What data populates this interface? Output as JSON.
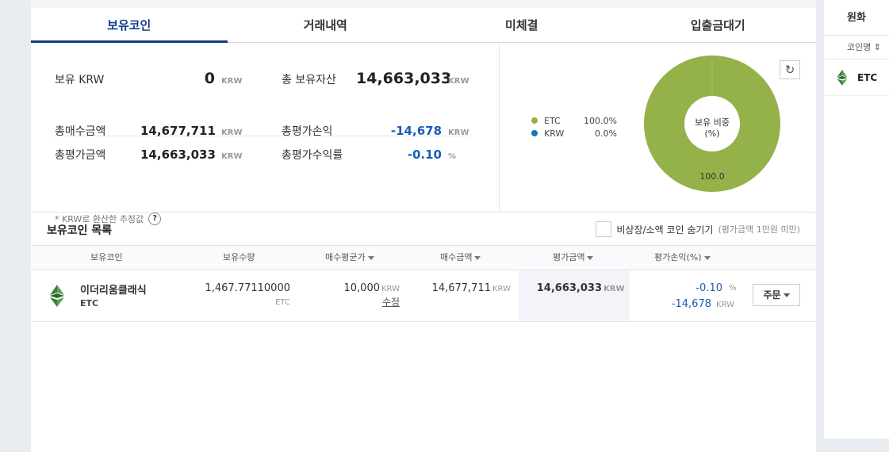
{
  "tabs": [
    {
      "label": "보유코인"
    },
    {
      "label": "거래내역"
    },
    {
      "label": "미체결"
    },
    {
      "label": "입출금대기"
    }
  ],
  "summary": {
    "krw_label": "보유 KRW",
    "krw_value": "0",
    "krw_unit": "KRW",
    "total_label": "총 보유자산",
    "total_value": "14,663,033",
    "total_unit": "KRW",
    "buy_label": "총매수금액",
    "buy_value": "14,677,711",
    "buy_unit": "KRW",
    "pl_label": "총평가손익",
    "pl_value": "-14,678",
    "pl_unit": "KRW",
    "eval_label": "총평가금액",
    "eval_value": "14,663,033",
    "eval_unit": "KRW",
    "rate_label": "총평가수익률",
    "rate_value": "-0.10",
    "rate_unit": "%",
    "note": "* KRW로 환산한 추정값",
    "help": "?"
  },
  "chart_data": {
    "type": "pie",
    "title": "보유 비중",
    "subtitle": "(%)",
    "series": [
      {
        "name": "ETC",
        "value": 100.0,
        "label": "100.0%",
        "color": "#94b14a"
      },
      {
        "name": "KRW",
        "value": 0.0,
        "label": "0.0%",
        "color": "#1e73b0"
      }
    ],
    "slice_label": "100.0"
  },
  "refresh_icon": "↻",
  "list": {
    "title": "보유코인 목록",
    "hide_label": "비상장/소액 코인 숨기기",
    "hide_sub": "(평가금액 1만원 미만)",
    "headers": {
      "coin": "보유코인",
      "qty": "보유수량",
      "avg": "매수평균가",
      "buy": "매수금액",
      "eval": "평가금액",
      "pl": "평가손익(%)"
    },
    "rows": [
      {
        "name": "이더리움클래식",
        "symbol": "ETC",
        "qty": "1,467.77110000",
        "qty_unit": "ETC",
        "avg": "10,000",
        "avg_unit": "KRW",
        "edit": "수정",
        "buy": "14,677,711",
        "buy_unit": "KRW",
        "eval": "14,663,033",
        "eval_unit": "KRW",
        "pl_rate": "-0.10",
        "pl_rate_unit": "%",
        "pl_amount": "-14,678",
        "pl_amount_unit": "KRW",
        "order": "주문"
      }
    ]
  },
  "side": {
    "title": "원화",
    "sort_label": "코인명 ⇕",
    "items": [
      {
        "symbol": "ETC"
      }
    ]
  }
}
